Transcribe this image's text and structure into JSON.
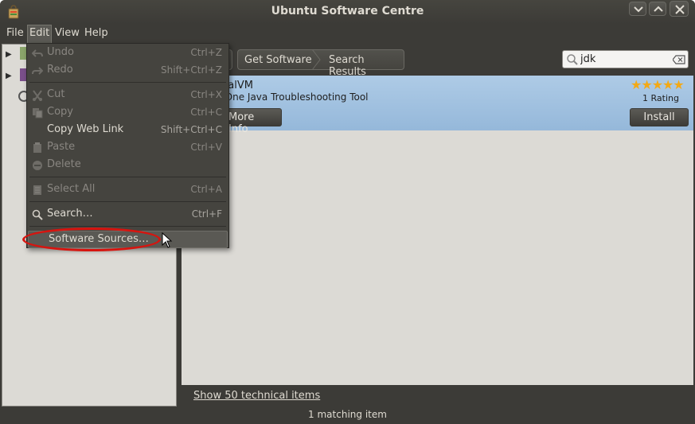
{
  "window": {
    "title": "Ubuntu Software Centre",
    "icon": "software-centre-icon"
  },
  "menubar": {
    "items": [
      {
        "label": "File"
      },
      {
        "label": "Edit"
      },
      {
        "label": "View"
      },
      {
        "label": "Help"
      }
    ]
  },
  "edit_menu": {
    "items": [
      {
        "label": "Undo",
        "shortcut": "Ctrl+Z",
        "icon": "undo-icon",
        "enabled": false
      },
      {
        "label": "Redo",
        "shortcut": "Shift+Ctrl+Z",
        "icon": "redo-icon",
        "enabled": false
      },
      {
        "label": "Cut",
        "shortcut": "Ctrl+X",
        "icon": "cut-icon",
        "enabled": false
      },
      {
        "label": "Copy",
        "shortcut": "Ctrl+C",
        "icon": "copy-icon",
        "enabled": false
      },
      {
        "label": "Copy Web Link",
        "shortcut": "Shift+Ctrl+C",
        "icon": "",
        "enabled": true
      },
      {
        "label": "Paste",
        "shortcut": "Ctrl+V",
        "icon": "paste-icon",
        "enabled": false
      },
      {
        "label": "Delete",
        "shortcut": "",
        "icon": "delete-icon",
        "enabled": false
      },
      {
        "label": "Select All",
        "shortcut": "Ctrl+A",
        "icon": "select-all-icon",
        "enabled": false
      },
      {
        "label": "Search…",
        "shortcut": "Ctrl+F",
        "icon": "search-icon",
        "enabled": true
      },
      {
        "label": "Software Sources…",
        "shortcut": "",
        "icon": "",
        "enabled": true
      }
    ]
  },
  "toolbar": {
    "breadcrumbs": [
      "Get Software",
      "Search Results"
    ],
    "search_value": "jdk"
  },
  "results": [
    {
      "name": "ualVM",
      "summary": "-One Java Troubleshooting Tool",
      "stars": "★★★★★",
      "rating": "1 Rating",
      "more_info_label": "More Info",
      "install_label": "Install"
    }
  ],
  "footer": {
    "technical_link": "Show 50 technical items"
  },
  "status": {
    "text": "1 matching item"
  },
  "colors": {
    "window_bg": "#3c3b37",
    "selection_blue": "#aecbe6",
    "annotation_red": "#d7140f",
    "star_orange": "#f3a916"
  }
}
